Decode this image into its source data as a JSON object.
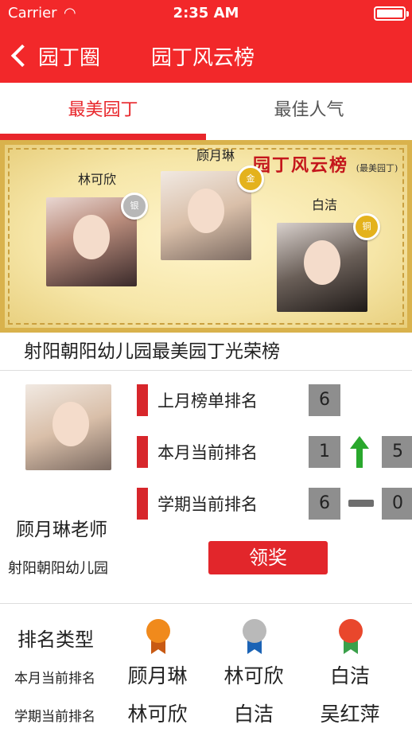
{
  "status": {
    "carrier": "Carrier",
    "time": "2:35 AM"
  },
  "nav": {
    "back_label": "园丁圈",
    "title": "园丁风云榜"
  },
  "tabs": [
    {
      "label": "最美园丁",
      "active": true
    },
    {
      "label": "最佳人气",
      "active": false
    }
  ],
  "banner": {
    "brand": "园丁风云榜",
    "brand_sub": "(最美园丁)",
    "first": {
      "name": "顾月琳",
      "medal": "gold"
    },
    "second": {
      "name": "林可欣",
      "medal": "silver"
    },
    "third": {
      "name": "白洁",
      "medal": "gold"
    }
  },
  "honor_title": "射阳朝阳幼儿园最美园丁光荣榜",
  "teacher": {
    "name": "顾月琳老师",
    "school": "射阳朝阳幼儿园",
    "rows": [
      {
        "label": "上月榜单排名",
        "value": "6"
      },
      {
        "label": "本月当前排名",
        "value": "1",
        "trend": "up",
        "change": "5"
      },
      {
        "label": "学期当前排名",
        "value": "6",
        "trend": "flat",
        "change": "0"
      }
    ],
    "award_button": "领奖"
  },
  "ranking": {
    "header": "排名类型",
    "medal_colors": [
      "#f08a1c",
      "#2f8de4",
      "#e9472c"
    ],
    "rows": [
      {
        "category": "本月当前排名",
        "names": [
          "顾月琳",
          "林可欣",
          "白洁"
        ]
      },
      {
        "category": "学期当前排名",
        "names": [
          "林可欣",
          "白洁",
          "吴红萍"
        ]
      }
    ]
  }
}
